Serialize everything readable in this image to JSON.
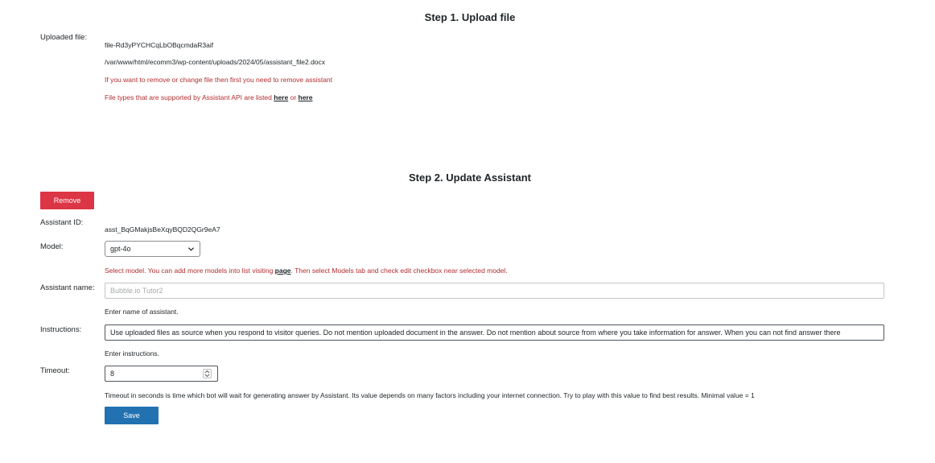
{
  "step1": {
    "title": "Step 1. Upload file",
    "uploaded_file_label": "Uploaded file:",
    "file_id": "file-Rd3yPYCHCqLbOBqcmdaR3aif",
    "file_path": "/var/www/html/ecomm3/wp-content/uploads/2024/05/assistant_file2.docx",
    "remove_notice": "If you want to remove or change file then first you need to remove assistant",
    "types_prefix": "File types that are supported by Assistant API are listed ",
    "types_link1": "here",
    "types_or": " or ",
    "types_link2": "here"
  },
  "step2": {
    "title": "Step 2. Update Assistant",
    "remove_label": "Remove",
    "assistant_id_label": "Assistant ID:",
    "assistant_id": "asst_BqGMakjsBeXqyBQD2QGr9eA7",
    "model_label": "Model:",
    "model_value": "gpt-4o",
    "model_help_prefix": "Select model. You can add more models into list visiting ",
    "model_help_link": "page",
    "model_help_suffix": ". Then select Models tab and check edit checkbox near selected model.",
    "name_label": "Assistant name:",
    "name_placeholder": "Bubble.io Tutor2",
    "name_help": "Enter name of assistant.",
    "instructions_label": "Instructions:",
    "instructions_value": "Use uploaded files as source when you respond to visitor queries. Do not mention uploaded document in the answer. Do not mention about source from where you take information for answer. When you can not find answer there",
    "instructions_help": "Enter instructions.",
    "timeout_label": "Timeout:",
    "timeout_value": "8",
    "timeout_help": "Timeout in seconds is time which bot will wait for generating answer by Assistant. Its value depends on many factors including your internet connection. Try to play with this value to find best results. Minimal value = 1",
    "save_label": "Save"
  }
}
